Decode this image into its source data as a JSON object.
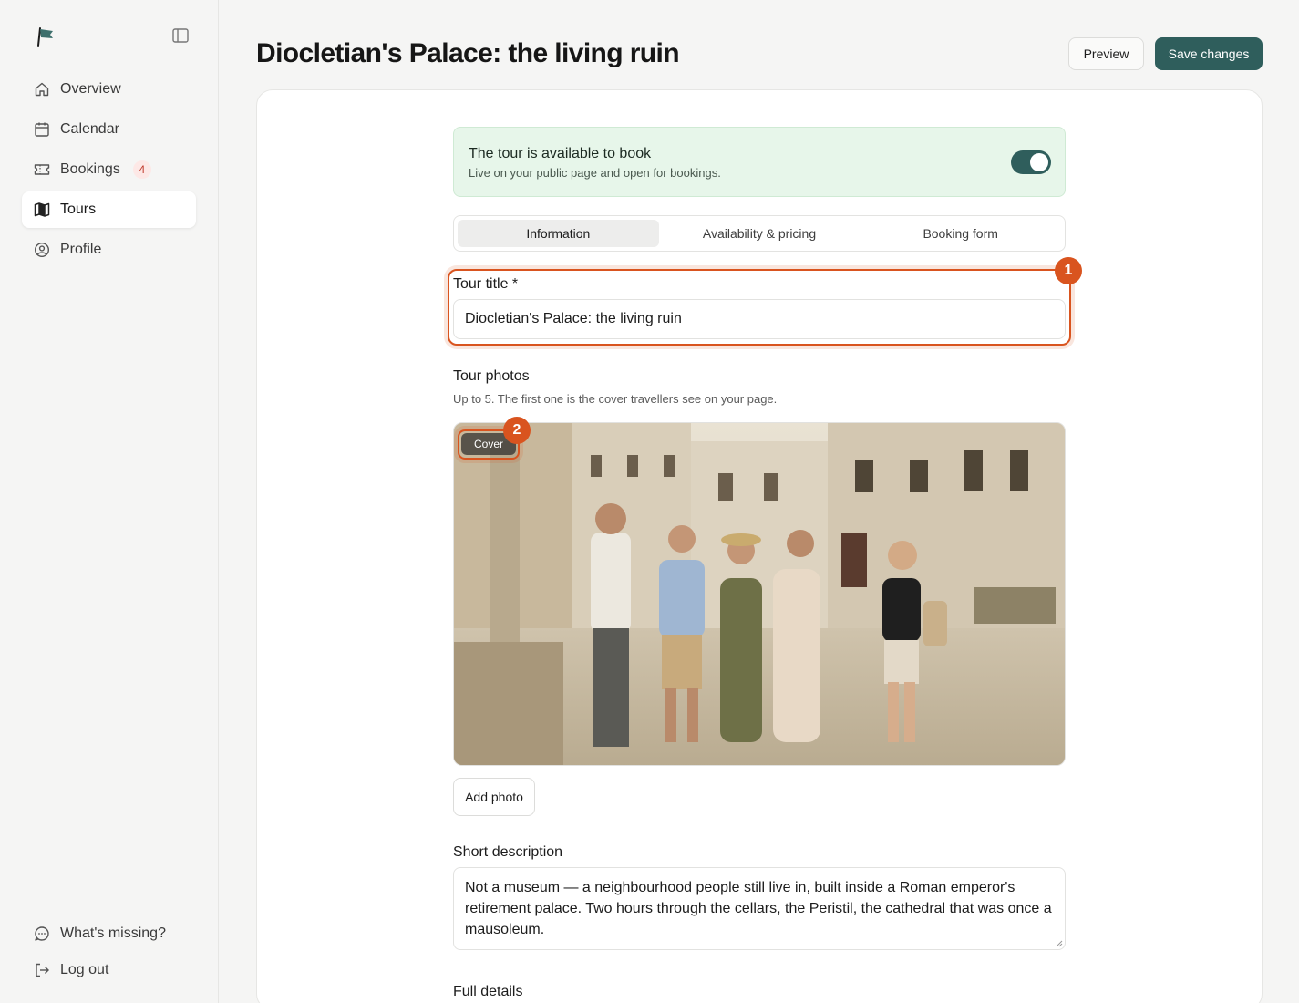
{
  "sidebar": {
    "logo_icon": "flag-logo",
    "items": [
      {
        "label": "Overview",
        "icon": "home-icon"
      },
      {
        "label": "Calendar",
        "icon": "calendar-icon"
      },
      {
        "label": "Bookings",
        "icon": "ticket-icon",
        "badge": "4"
      },
      {
        "label": "Tours",
        "icon": "map-icon",
        "active": true
      },
      {
        "label": "Profile",
        "icon": "user-circle-icon"
      }
    ],
    "bottom": [
      {
        "label": "What's missing?",
        "icon": "chat-icon"
      },
      {
        "label": "Log out",
        "icon": "logout-icon"
      }
    ]
  },
  "header": {
    "title": "Diocletian's Palace: the living ruin",
    "preview_label": "Preview",
    "save_label": "Save changes"
  },
  "availability": {
    "title": "The tour is available to book",
    "subtitle": "Live on your public page and open for bookings.",
    "enabled": true
  },
  "tabs": [
    {
      "label": "Information",
      "active": true
    },
    {
      "label": "Availability & pricing"
    },
    {
      "label": "Booking form"
    }
  ],
  "form": {
    "title_label": "Tour title *",
    "title_value": "Diocletian's Palace: the living ruin",
    "photos_label": "Tour photos",
    "photos_hint": "Up to 5. The first one is the cover travellers see on your page.",
    "cover_label": "Cover",
    "add_photo_label": "Add photo",
    "short_desc_label": "Short description",
    "short_desc_value": "Not a museum — a neighbourhood people still live in, built inside a Roman emperor's retirement palace. Two hours through the cellars, the Peristil, the cathedral that was once a mausoleum.",
    "full_details_label": "Full details"
  },
  "annotations": [
    "1",
    "2"
  ],
  "colors": {
    "accent": "#2f5e5c",
    "highlight": "#d9541f",
    "available_bg": "#e7f6ea",
    "badge_text": "#c0392b"
  }
}
